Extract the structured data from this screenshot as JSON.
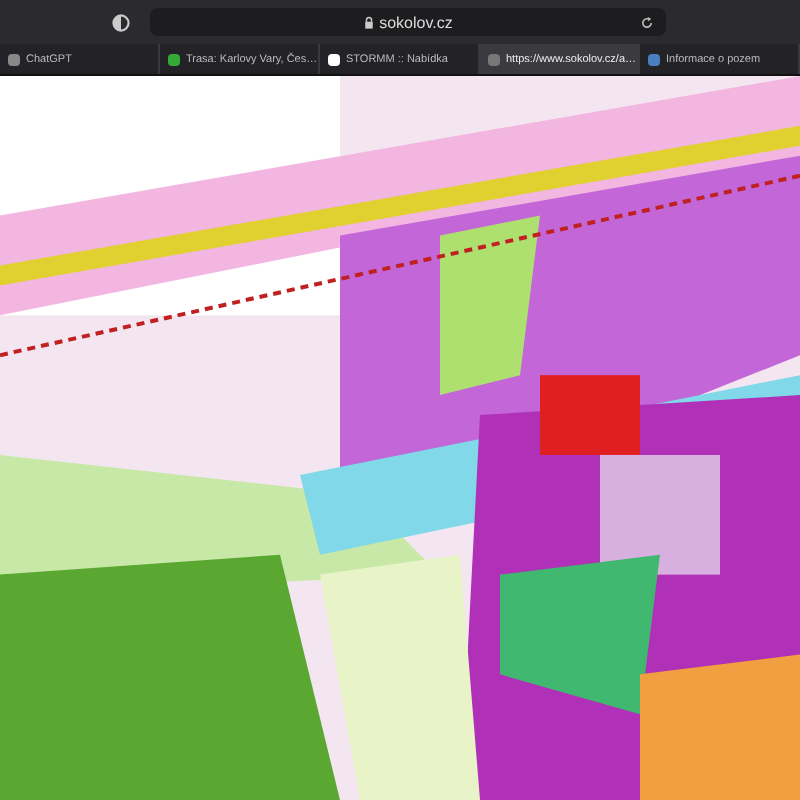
{
  "address_bar": {
    "url": "sokolov.cz"
  },
  "tabs": [
    {
      "title": "ChatGPT",
      "selected": false
    },
    {
      "title": "Trasa: Karlovy Vary, Čes…",
      "selected": false
    },
    {
      "title": "STORMM :: Nabídka",
      "selected": false
    },
    {
      "title": "https://www.sokolov.cz/a…",
      "selected": true
    },
    {
      "title": "Informace o pozem",
      "selected": false
    }
  ]
}
